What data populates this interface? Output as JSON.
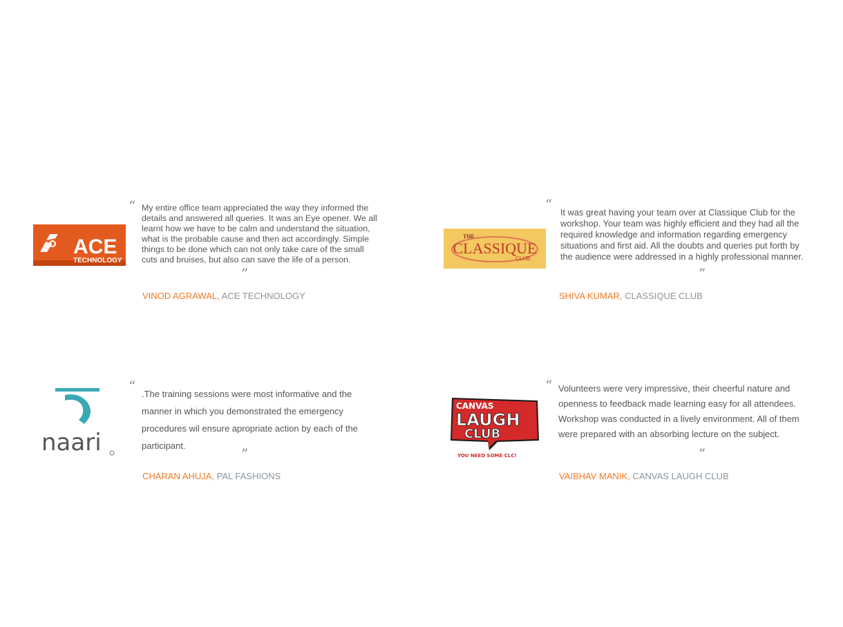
{
  "testimonials": [
    {
      "logo_icon": "ace-technology-logo",
      "logo": {
        "line1": "ACE",
        "line2": "TECHNOLOGY"
      },
      "quote": "My entire office team appreciated the way they informed the details and answered all queries. It was an Eye opener. We all learnt how we have to be calm and understand the situation, what is the probable cause and then act accordingly. Simple things to be done which can not only take care of the small cuts and bruises, but also can save the life of a person.",
      "name": "VINOD AGRAWAL,",
      "company": "ACE TECHNOLOGY"
    },
    {
      "logo_icon": "classique-club-logo",
      "logo": {
        "top": "THE",
        "main": "CLASSIQUE",
        "sub": "CLUB"
      },
      "quote": "It was great having your team over at Classique Club for the workshop. Your team was highly efficient and they had all the required knowledge and information regarding emergency situations and first aid. All the doubts and queries put forth by the audience were addressed in a highly professional manner.",
      "name": "SHIVA KUMAR,",
      "company": "CLASSIQUE CLUB"
    },
    {
      "logo_icon": "naari-logo",
      "logo": {
        "text": "naari"
      },
      "quote": ".The training sessions were most informative and the manner in which you demonstrated the emergency procedures wil ensure apropriate action by each of the participant.",
      "name": "CHARAN AHUJA,",
      "company": "PAL FASHIONS"
    },
    {
      "logo_icon": "canvas-laugh-club-logo",
      "logo": {
        "line1": "CANVAS",
        "line2": "LAUGH",
        "line3": "CLUB",
        "tagline": "YOU NEED SOME CLC!"
      },
      "quote": "Volunteers were very impressive, their cheerful nature and openness to feedback made learning easy for all attendees. Workshop was conducted in a lively environment. All of them were prepared with an absorbing lecture on the subject.",
      "name": "VAIBHAV MANIK,",
      "company": "CANVAS LAUGH CLUB"
    }
  ],
  "colors": {
    "name": "#ee7a26",
    "company": "#8b949c",
    "quote_text": "#555555",
    "quote_marks": "#8a8a8a"
  }
}
